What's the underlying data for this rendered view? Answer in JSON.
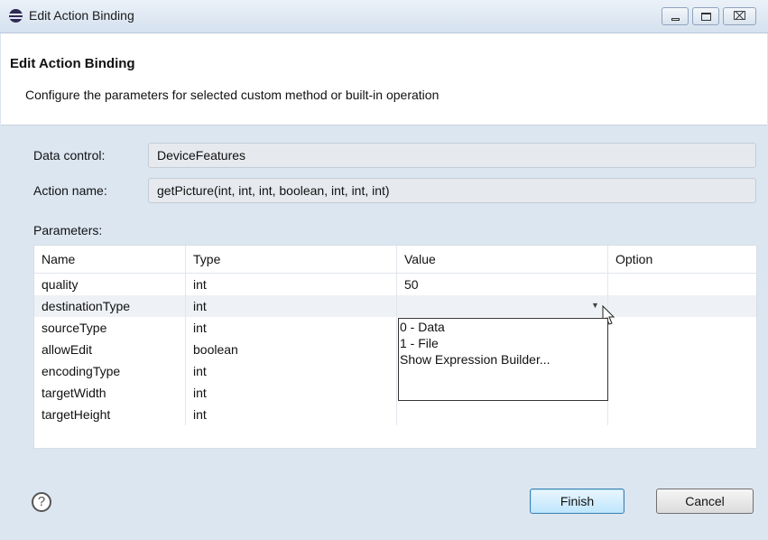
{
  "window": {
    "title": "Edit Action Binding",
    "controls": {
      "minimize": "minimize",
      "maximize": "maximize",
      "close": "⌧"
    }
  },
  "header": {
    "title": "Edit Action Binding",
    "description": "Configure the parameters for selected custom method or built-in operation"
  },
  "fields": {
    "data_control_label": "Data control:",
    "data_control_value": "DeviceFeatures",
    "action_name_label": "Action name:",
    "action_name_value": "getPicture(int, int, int, boolean, int, int, int)"
  },
  "parameters": {
    "label": "Parameters:",
    "columns": [
      "Name",
      "Type",
      "Value",
      "Option"
    ],
    "rows": [
      {
        "name": "quality",
        "type": "int",
        "value": "50",
        "option": ""
      },
      {
        "name": "destinationType",
        "type": "int",
        "value": "",
        "option": ""
      },
      {
        "name": "sourceType",
        "type": "int",
        "value": "",
        "option": ""
      },
      {
        "name": "allowEdit",
        "type": "boolean",
        "value": "",
        "option": ""
      },
      {
        "name": "encodingType",
        "type": "int",
        "value": "",
        "option": ""
      },
      {
        "name": "targetWidth",
        "type": "int",
        "value": "",
        "option": ""
      },
      {
        "name": "targetHeight",
        "type": "int",
        "value": "",
        "option": ""
      }
    ],
    "selected_row": "destinationType"
  },
  "dropdown": {
    "options": [
      "0 - Data",
      "1 - File",
      "Show Expression Builder..."
    ]
  },
  "footer": {
    "help_icon": "?",
    "finish_label": "Finish",
    "cancel_label": "Cancel"
  },
  "icons": {
    "app": "eclipse-icon",
    "help": "help-icon",
    "dropdown": "chevron-down-icon"
  }
}
